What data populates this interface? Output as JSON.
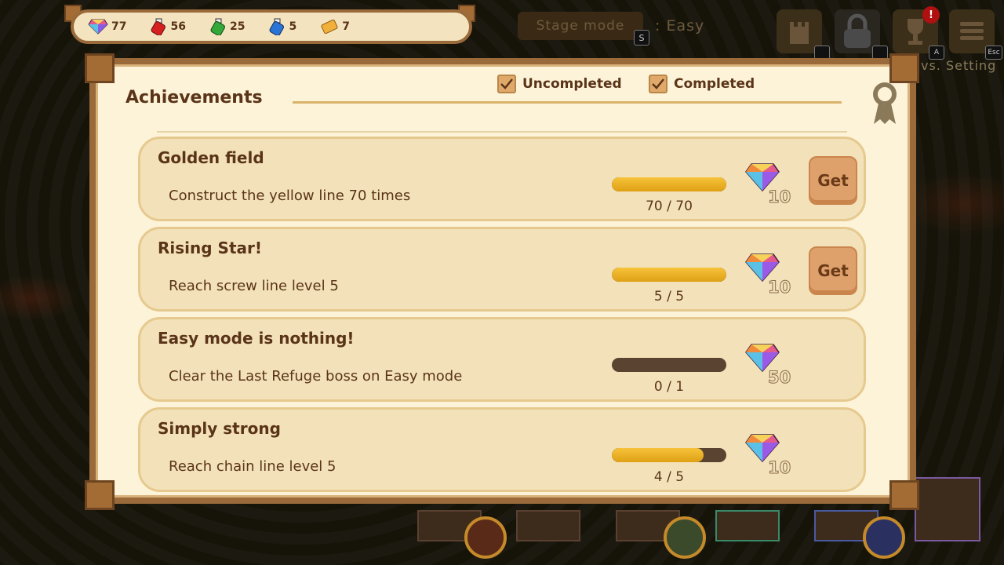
{
  "resources": [
    {
      "icon": "diamond-icon",
      "value": "77",
      "color": "#c04040"
    },
    {
      "icon": "red-potion-icon",
      "value": "56",
      "color": "#d02020"
    },
    {
      "icon": "green-potion-icon",
      "value": "25",
      "color": "#30a030"
    },
    {
      "icon": "blue-potion-icon",
      "value": "5",
      "color": "#2a70d0"
    },
    {
      "icon": "ticket-icon",
      "value": "7",
      "color": "#e0a030"
    }
  ],
  "header": {
    "stage_mode_label": "Stage mode",
    "stage_mode_key": "S",
    "stage_mode_value": ": Easy",
    "achievements_key": "A",
    "menu_key": "Esc",
    "vs_setting_label": "vs. Setting",
    "badge": "!"
  },
  "panel": {
    "title": "Achievements",
    "filters": [
      {
        "label": "Uncompleted",
        "checked": true
      },
      {
        "label": "Completed",
        "checked": true
      }
    ]
  },
  "achievements": [
    {
      "name": "Golden field",
      "description": "Construct the yellow line 70 times",
      "progress_text": "70 / 70",
      "progress": 1.0,
      "reward": "10",
      "button": "Get"
    },
    {
      "name": "Rising Star!",
      "description": "Reach screw line level 5",
      "progress_text": "5 / 5",
      "progress": 1.0,
      "reward": "10",
      "button": "Get"
    },
    {
      "name": "Easy mode is nothing!",
      "description": "Clear the Last Refuge boss on Easy mode",
      "progress_text": "0 / 1",
      "progress": 0.0,
      "reward": "50",
      "button": ""
    },
    {
      "name": "Simply strong",
      "description": "Reach chain line level 5",
      "progress_text": "4 / 5",
      "progress": 0.8,
      "reward": "10",
      "button": ""
    }
  ]
}
